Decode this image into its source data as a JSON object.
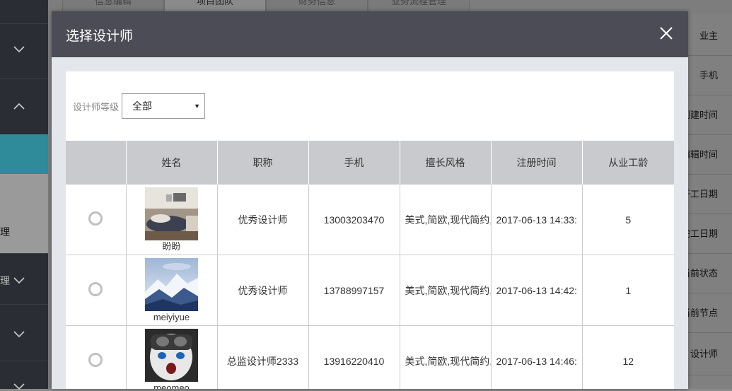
{
  "background": {
    "tabs": [
      "信息编辑",
      "项目团队",
      "财务信息",
      "业务流程管理"
    ],
    "sidebar_labels": [
      "理",
      "理"
    ],
    "right_labels": [
      "业主",
      "手机",
      "创建时间",
      "编辑时间",
      "开工日期",
      "完工日期",
      "当前状态",
      "当前节点",
      "设计师"
    ]
  },
  "modal": {
    "title": "选择设计师",
    "filter": {
      "label": "设计师等级",
      "value": "全部"
    },
    "columns": [
      "",
      "姓名",
      "职称",
      "手机",
      "擅长风格",
      "注册时间",
      "从业工龄"
    ],
    "rows": [
      {
        "name": "盼盼",
        "title": "优秀设计师",
        "phone": "13003203470",
        "style": "美式,简欧,现代简约,",
        "registered": "2017-06-13 14:33:",
        "years": "5",
        "avatar": "bedroom-photo"
      },
      {
        "name": "meiyiyue",
        "title": "优秀设计师",
        "phone": "13788997157",
        "style": "美式,简欧,现代简约,",
        "registered": "2017-06-13 14:42:",
        "years": "1",
        "avatar": "snowy-mountain-photo"
      },
      {
        "name": "meomeo",
        "title": "总监设计师2333",
        "phone": "13916220410",
        "style": "美式,简欧,现代简约,",
        "registered": "2017-06-13 14:46:",
        "years": "12",
        "avatar": "anime-character-photo"
      }
    ]
  },
  "colors": {
    "header": "#4b4c55",
    "sidebar_active": "#2f8a99",
    "table_header": "#c8cacd"
  }
}
